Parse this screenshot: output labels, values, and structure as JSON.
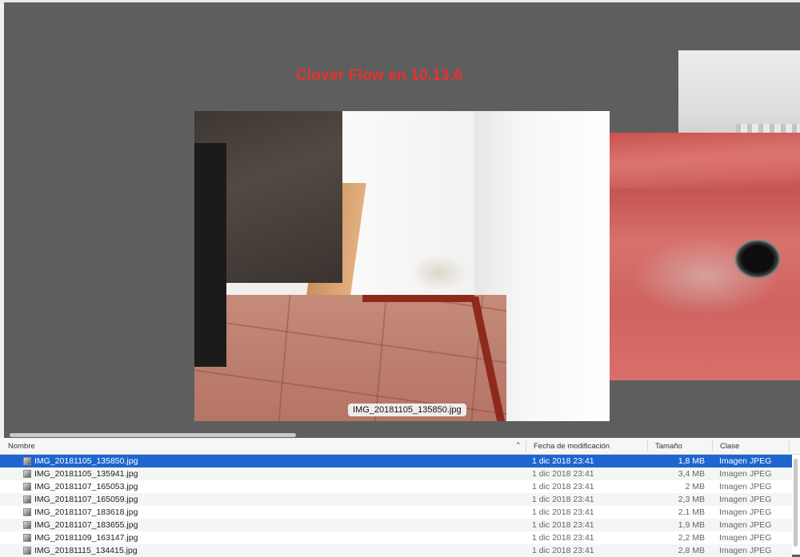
{
  "overlay_title": "Clover Flow en 10.13.6",
  "coverflow": {
    "caption": "IMG_20181105_135850.jpg"
  },
  "list": {
    "columns": {
      "name": "Nombre",
      "date": "Fecha de modificación",
      "size": "Tamaño",
      "kind": "Clase"
    },
    "rows": [
      {
        "name": "IMG_20181105_135850.jpg",
        "date": "1 dic 2018 23:41",
        "size": "1,8 MB",
        "kind": "Imagen JPEG",
        "selected": true
      },
      {
        "name": "IMG_20181105_135941.jpg",
        "date": "1 dic 2018 23:41",
        "size": "3,4 MB",
        "kind": "Imagen JPEG"
      },
      {
        "name": "IMG_20181107_165053.jpg",
        "date": "1 dic 2018 23:41",
        "size": "2 MB",
        "kind": "Imagen JPEG"
      },
      {
        "name": "IMG_20181107_165059.jpg",
        "date": "1 dic 2018 23:41",
        "size": "2,3 MB",
        "kind": "Imagen JPEG"
      },
      {
        "name": "IMG_20181107_183618.jpg",
        "date": "1 dic 2018 23:41",
        "size": "2,1 MB",
        "kind": "Imagen JPEG"
      },
      {
        "name": "IMG_20181107_183655.jpg",
        "date": "1 dic 2018 23:41",
        "size": "1,9 MB",
        "kind": "Imagen JPEG"
      },
      {
        "name": "IMG_20181109_163147.jpg",
        "date": "1 dic 2018 23:41",
        "size": "2,2 MB",
        "kind": "Imagen JPEG"
      },
      {
        "name": "IMG_20181115_134415.jpg",
        "date": "1 dic 2018 23:41",
        "size": "2,8 MB",
        "kind": "Imagen JPEG"
      }
    ]
  },
  "colors": {
    "title_red": "#e8312e",
    "selection_blue": "#1e65d0",
    "flow_background": "#5e5e5e"
  }
}
